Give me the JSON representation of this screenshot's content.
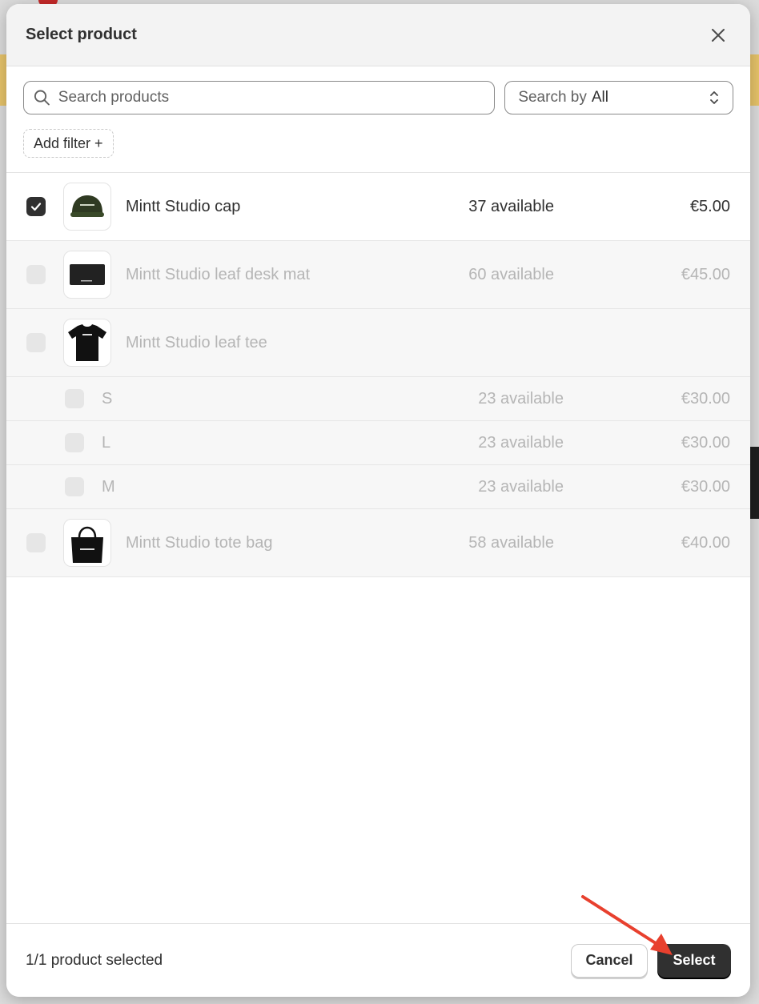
{
  "modal": {
    "title": "Select product",
    "search": {
      "placeholder": "Search products",
      "value": ""
    },
    "search_by": {
      "prefix": "Search by",
      "value": "All"
    },
    "add_filter_label": "Add filter +",
    "products": [
      {
        "name": "Mintt Studio cap",
        "available": "37 available",
        "price": "€5.00",
        "checked": true,
        "disabled": false,
        "image": "green-cap"
      },
      {
        "name": "Mintt Studio leaf desk mat",
        "available": "60 available",
        "price": "€45.00",
        "checked": false,
        "disabled": true,
        "image": "black-desk-mat"
      },
      {
        "name": "Mintt Studio leaf tee",
        "available": "",
        "price": "",
        "checked": false,
        "disabled": true,
        "image": "black-tee",
        "variants": [
          {
            "name": "S",
            "available": "23 available",
            "price": "€30.00"
          },
          {
            "name": "L",
            "available": "23 available",
            "price": "€30.00"
          },
          {
            "name": "M",
            "available": "23 available",
            "price": "€30.00"
          }
        ]
      },
      {
        "name": "Mintt Studio tote bag",
        "available": "58 available",
        "price": "€40.00",
        "checked": false,
        "disabled": true,
        "image": "black-tote-bag"
      }
    ],
    "footer": {
      "status": "1/1 product selected",
      "cancel_label": "Cancel",
      "select_label": "Select"
    }
  },
  "colors": {
    "primary_button": "#303030",
    "annotation_arrow": "#e8402e"
  }
}
